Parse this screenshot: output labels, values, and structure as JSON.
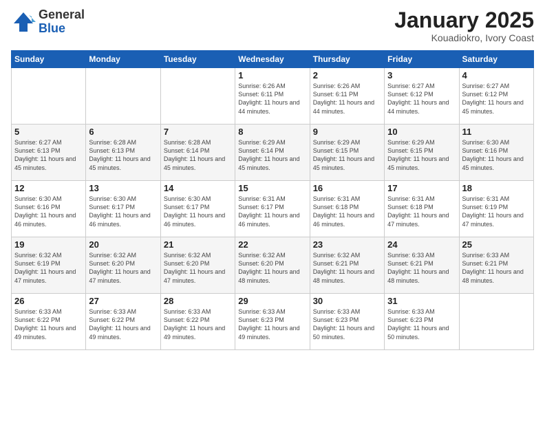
{
  "header": {
    "logo_general": "General",
    "logo_blue": "Blue",
    "month_title": "January 2025",
    "location": "Kouadiokro, Ivory Coast"
  },
  "days_of_week": [
    "Sunday",
    "Monday",
    "Tuesday",
    "Wednesday",
    "Thursday",
    "Friday",
    "Saturday"
  ],
  "weeks": [
    [
      {
        "day": "",
        "info": ""
      },
      {
        "day": "",
        "info": ""
      },
      {
        "day": "",
        "info": ""
      },
      {
        "day": "1",
        "info": "Sunrise: 6:26 AM\nSunset: 6:11 PM\nDaylight: 11 hours and 44 minutes."
      },
      {
        "day": "2",
        "info": "Sunrise: 6:26 AM\nSunset: 6:11 PM\nDaylight: 11 hours and 44 minutes."
      },
      {
        "day": "3",
        "info": "Sunrise: 6:27 AM\nSunset: 6:12 PM\nDaylight: 11 hours and 44 minutes."
      },
      {
        "day": "4",
        "info": "Sunrise: 6:27 AM\nSunset: 6:12 PM\nDaylight: 11 hours and 45 minutes."
      }
    ],
    [
      {
        "day": "5",
        "info": "Sunrise: 6:27 AM\nSunset: 6:13 PM\nDaylight: 11 hours and 45 minutes."
      },
      {
        "day": "6",
        "info": "Sunrise: 6:28 AM\nSunset: 6:13 PM\nDaylight: 11 hours and 45 minutes."
      },
      {
        "day": "7",
        "info": "Sunrise: 6:28 AM\nSunset: 6:14 PM\nDaylight: 11 hours and 45 minutes."
      },
      {
        "day": "8",
        "info": "Sunrise: 6:29 AM\nSunset: 6:14 PM\nDaylight: 11 hours and 45 minutes."
      },
      {
        "day": "9",
        "info": "Sunrise: 6:29 AM\nSunset: 6:15 PM\nDaylight: 11 hours and 45 minutes."
      },
      {
        "day": "10",
        "info": "Sunrise: 6:29 AM\nSunset: 6:15 PM\nDaylight: 11 hours and 45 minutes."
      },
      {
        "day": "11",
        "info": "Sunrise: 6:30 AM\nSunset: 6:16 PM\nDaylight: 11 hours and 45 minutes."
      }
    ],
    [
      {
        "day": "12",
        "info": "Sunrise: 6:30 AM\nSunset: 6:16 PM\nDaylight: 11 hours and 46 minutes."
      },
      {
        "day": "13",
        "info": "Sunrise: 6:30 AM\nSunset: 6:17 PM\nDaylight: 11 hours and 46 minutes."
      },
      {
        "day": "14",
        "info": "Sunrise: 6:30 AM\nSunset: 6:17 PM\nDaylight: 11 hours and 46 minutes."
      },
      {
        "day": "15",
        "info": "Sunrise: 6:31 AM\nSunset: 6:17 PM\nDaylight: 11 hours and 46 minutes."
      },
      {
        "day": "16",
        "info": "Sunrise: 6:31 AM\nSunset: 6:18 PM\nDaylight: 11 hours and 46 minutes."
      },
      {
        "day": "17",
        "info": "Sunrise: 6:31 AM\nSunset: 6:18 PM\nDaylight: 11 hours and 47 minutes."
      },
      {
        "day": "18",
        "info": "Sunrise: 6:31 AM\nSunset: 6:19 PM\nDaylight: 11 hours and 47 minutes."
      }
    ],
    [
      {
        "day": "19",
        "info": "Sunrise: 6:32 AM\nSunset: 6:19 PM\nDaylight: 11 hours and 47 minutes."
      },
      {
        "day": "20",
        "info": "Sunrise: 6:32 AM\nSunset: 6:20 PM\nDaylight: 11 hours and 47 minutes."
      },
      {
        "day": "21",
        "info": "Sunrise: 6:32 AM\nSunset: 6:20 PM\nDaylight: 11 hours and 47 minutes."
      },
      {
        "day": "22",
        "info": "Sunrise: 6:32 AM\nSunset: 6:20 PM\nDaylight: 11 hours and 48 minutes."
      },
      {
        "day": "23",
        "info": "Sunrise: 6:32 AM\nSunset: 6:21 PM\nDaylight: 11 hours and 48 minutes."
      },
      {
        "day": "24",
        "info": "Sunrise: 6:33 AM\nSunset: 6:21 PM\nDaylight: 11 hours and 48 minutes."
      },
      {
        "day": "25",
        "info": "Sunrise: 6:33 AM\nSunset: 6:21 PM\nDaylight: 11 hours and 48 minutes."
      }
    ],
    [
      {
        "day": "26",
        "info": "Sunrise: 6:33 AM\nSunset: 6:22 PM\nDaylight: 11 hours and 49 minutes."
      },
      {
        "day": "27",
        "info": "Sunrise: 6:33 AM\nSunset: 6:22 PM\nDaylight: 11 hours and 49 minutes."
      },
      {
        "day": "28",
        "info": "Sunrise: 6:33 AM\nSunset: 6:22 PM\nDaylight: 11 hours and 49 minutes."
      },
      {
        "day": "29",
        "info": "Sunrise: 6:33 AM\nSunset: 6:23 PM\nDaylight: 11 hours and 49 minutes."
      },
      {
        "day": "30",
        "info": "Sunrise: 6:33 AM\nSunset: 6:23 PM\nDaylight: 11 hours and 50 minutes."
      },
      {
        "day": "31",
        "info": "Sunrise: 6:33 AM\nSunset: 6:23 PM\nDaylight: 11 hours and 50 minutes."
      },
      {
        "day": "",
        "info": ""
      }
    ]
  ]
}
